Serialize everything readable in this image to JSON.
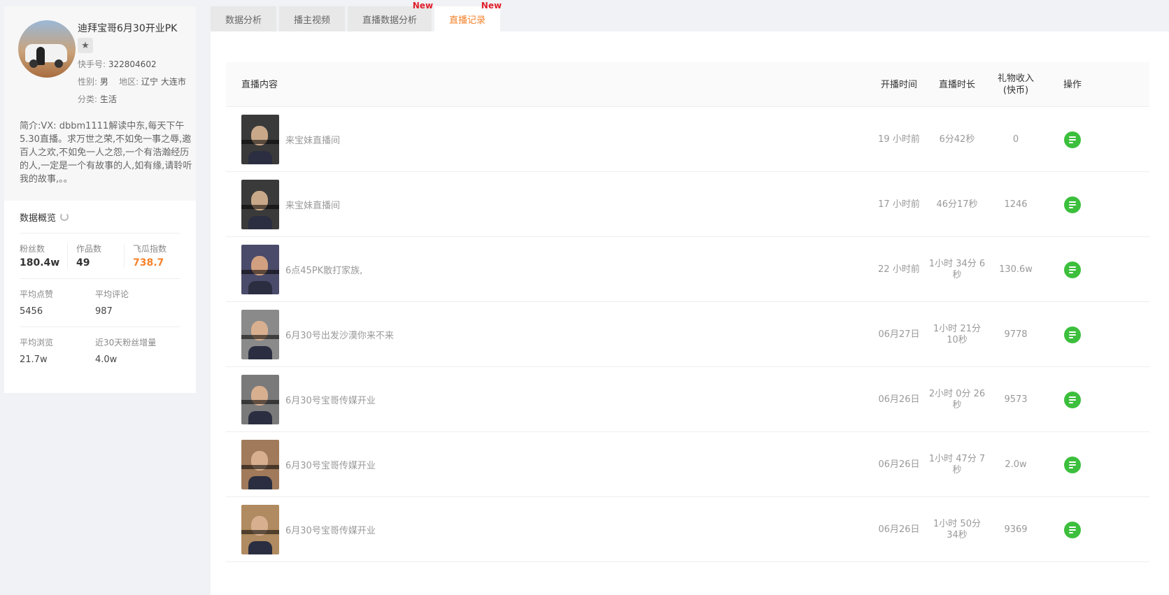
{
  "profile": {
    "name": "迪拜宝哥6月30开业PK",
    "kuaishou_label": "快手号:",
    "kuaishou_id": "322804602",
    "gender_label": "性别:",
    "gender": "男",
    "region_label": "地区:",
    "region": "辽宁 大连市",
    "category_label": "分类:",
    "category": "生活",
    "bio": "简介:VX: dbbm1111解读中东,每天下午5.30直播。求万世之荣,不如免一事之辱,邀百人之欢,不如免一人之怨,一个有浩瀚经历的人,一定是一个有故事的人,如有缘,请聆听我的故事,。。"
  },
  "overview": {
    "title": "数据概览",
    "fans_label": "粉丝数",
    "fans": "180.4w",
    "works_label": "作品数",
    "works": "49",
    "index_label": "飞瓜指数",
    "index": "738.7",
    "avg_likes_label": "平均点赞",
    "avg_likes": "5456",
    "avg_comments_label": "平均评论",
    "avg_comments": "987",
    "avg_views_label": "平均浏览",
    "avg_views": "21.7w",
    "fans_growth_label": "近30天粉丝增量",
    "fans_growth": "4.0w"
  },
  "tabs": [
    {
      "label": "数据分析",
      "badge": ""
    },
    {
      "label": "播主视频",
      "badge": ""
    },
    {
      "label": "直播数据分析",
      "badge": "New"
    },
    {
      "label": "直播记录",
      "badge": "New"
    }
  ],
  "table": {
    "headers": {
      "content": "直播内容",
      "start": "开播时间",
      "duration": "直播时长",
      "gift_line1": "礼物收入",
      "gift_line2": "(快币)",
      "op": "操作"
    },
    "rows": [
      {
        "title": "来宝妹直播间",
        "start": "19 小时前",
        "duration": "6分42秒",
        "gift": "0"
      },
      {
        "title": "来宝妹直播间",
        "start": "17 小时前",
        "duration": "46分17秒",
        "gift": "1246"
      },
      {
        "title": "6点45PK散打家族,",
        "start": "22 小时前",
        "duration": "1小时 34分 6秒",
        "gift": "130.6w"
      },
      {
        "title": "6月30号出发沙漠你来不来",
        "start": "06月27日",
        "duration": "1小时 21分 10秒",
        "gift": "9778"
      },
      {
        "title": "6月30号宝哥传媒开业",
        "start": "06月26日",
        "duration": "2小时 0分 26秒",
        "gift": "9573"
      },
      {
        "title": "6月30号宝哥传媒开业",
        "start": "06月26日",
        "duration": "1小时 47分 7秒",
        "gift": "2.0w"
      },
      {
        "title": "6月30号宝哥传媒开业",
        "start": "06月26日",
        "duration": "1小时 50分 34秒",
        "gift": "9369"
      }
    ]
  }
}
